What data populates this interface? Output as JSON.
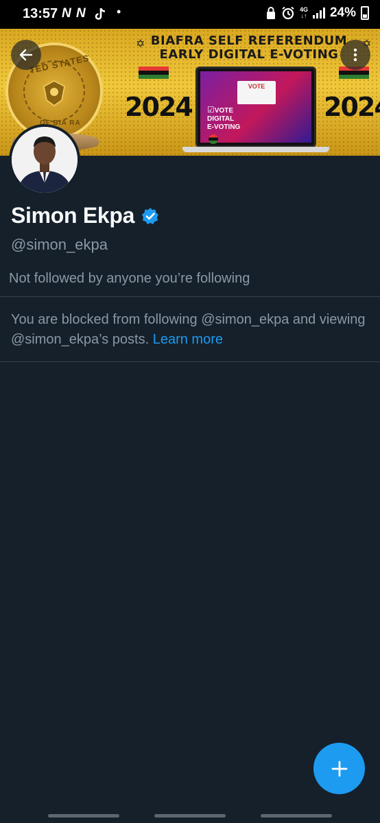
{
  "status_bar": {
    "time": "13:57",
    "left_icons": "N N",
    "network": "4G",
    "battery": "24%"
  },
  "banner": {
    "title_line1": "BIAFRA SELF REFERENDUM",
    "title_line2": "EARLY DIGITAL E-VOTING",
    "year_left": "2024",
    "year_right": "2024",
    "seal_text": "TED STATES",
    "seal_text_bottom": "OF BIA RA",
    "laptop_vote": "VOTE",
    "laptop_label_line1": "VOTE",
    "laptop_label_line2": "DIGITAL",
    "laptop_label_line3": "E-VOTING",
    "flag_colors": [
      "#e53935",
      "#111111",
      "#2e7d32"
    ]
  },
  "profile": {
    "name": "Simon Ekpa",
    "handle": "@simon_ekpa",
    "verified": true,
    "followed_by": "Not followed by anyone you’re following",
    "blocked_message": "You are blocked from following @simon_ekpa and viewing @simon_ekpa’s posts.",
    "learn_more": "Learn more"
  },
  "icons": {
    "back": "arrow-left-icon",
    "more": "more-vertical-icon",
    "verified": "verified-badge-icon",
    "compose": "plus-icon"
  },
  "colors": {
    "background": "#15202b",
    "accent": "#1d9bf0",
    "secondary_text": "#8b98a5"
  }
}
